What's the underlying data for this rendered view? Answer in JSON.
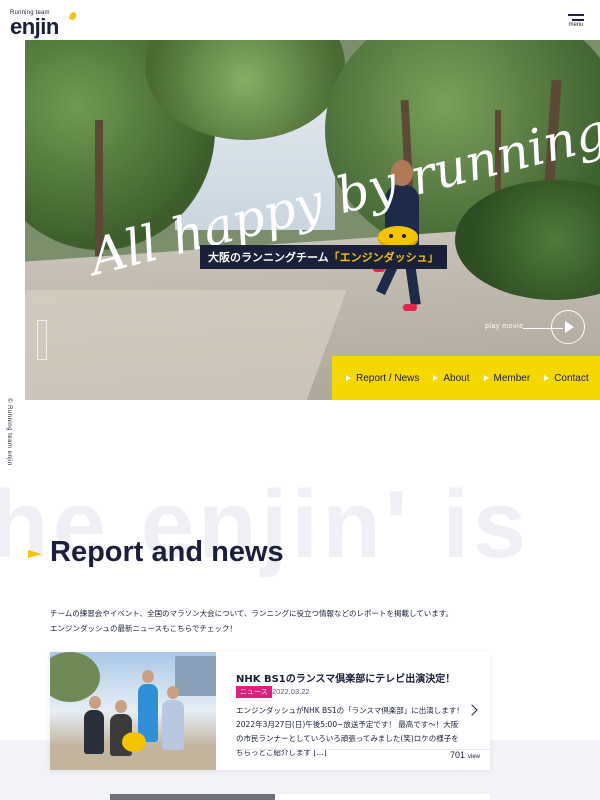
{
  "header": {
    "logo_tagline": "Running team",
    "logo_word": "enjin",
    "menu_label": "menu"
  },
  "side": {
    "copyright": "© Running team enjin"
  },
  "hero": {
    "script_text": "All happy by running.",
    "subtitle_prefix": "大阪のランニングチーム",
    "subtitle_highlight": "「エンジンダッシュ」",
    "play_label": "play movie"
  },
  "nav": {
    "items": [
      {
        "label": "Report / News"
      },
      {
        "label": "About"
      },
      {
        "label": "Member"
      },
      {
        "label": "Contact"
      }
    ]
  },
  "watermark": "he enjin' is",
  "report": {
    "title": "Report and news",
    "desc_line1": "チームの練習会やイベント、全国のマラソン大会について、ランニングに役立つ情報などのレポートを掲載しています。",
    "desc_line2": "エンジンダッシュの最新ニュースもこちらでチェック！"
  },
  "card": {
    "title": "NHK BS1のランスマ倶楽部にテレビ出演決定！",
    "tag": "ニュース",
    "date": "2022.03.22",
    "body": "エンジンダッシュがNHK BS1の「ランスマ倶楽部」に出演します！2022年3月27日(日)午後5:00~放送予定です！ 最高です〜！大阪の市民ランナーとしていろいろ頑張ってみました(笑)ロケの様子をちらっとご紹介します […]",
    "views": "701",
    "views_unit": "view"
  },
  "colors": {
    "accent_yellow": "#f5d800",
    "navy": "#1a1f3a",
    "tag_pink": "#e21d7a"
  }
}
